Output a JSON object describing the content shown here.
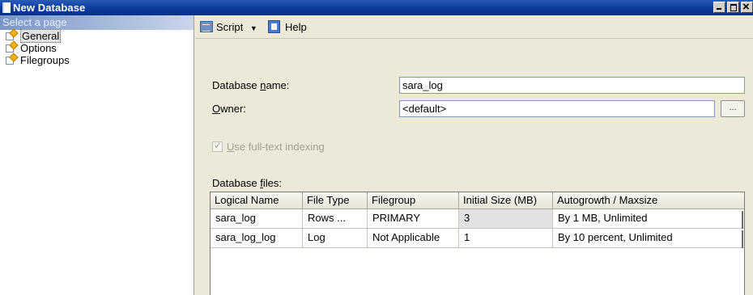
{
  "window": {
    "title": "New Database"
  },
  "left_pane": {
    "header": "Select a page",
    "pages": [
      {
        "label": "General",
        "icon": "page-settings-icon",
        "selected": true
      },
      {
        "label": "Options",
        "icon": "page-settings-icon",
        "selected": false
      },
      {
        "label": "Filegroups",
        "icon": "page-settings-icon",
        "selected": false
      }
    ]
  },
  "toolbar": {
    "script_label": "Script",
    "help_label": "Help"
  },
  "form": {
    "db_name_label_pre": "Database ",
    "db_name_label_key": "n",
    "db_name_label_post": "ame:",
    "db_name_value": "sara_log",
    "owner_label_key": "O",
    "owner_label_post": "wner:",
    "owner_value": "<default>",
    "browse_label": "...",
    "fulltext_key": "U",
    "fulltext_post": "se full-text indexing",
    "fulltext_checked": true,
    "files_label_pre": "Database ",
    "files_label_key": "f",
    "files_label_post": "iles:"
  },
  "files_grid": {
    "columns": [
      "Logical Name",
      "File Type",
      "Filegroup",
      "Initial Size (MB)",
      "Autogrowth / Maxsize"
    ],
    "rows": [
      [
        "sara_log",
        "Rows ...",
        "PRIMARY",
        "3",
        "By 1 MB, Unlimited"
      ],
      [
        "sara_log_log",
        "Log",
        "Not Applicable",
        "1",
        "By 10 percent, Unlimited"
      ]
    ]
  }
}
